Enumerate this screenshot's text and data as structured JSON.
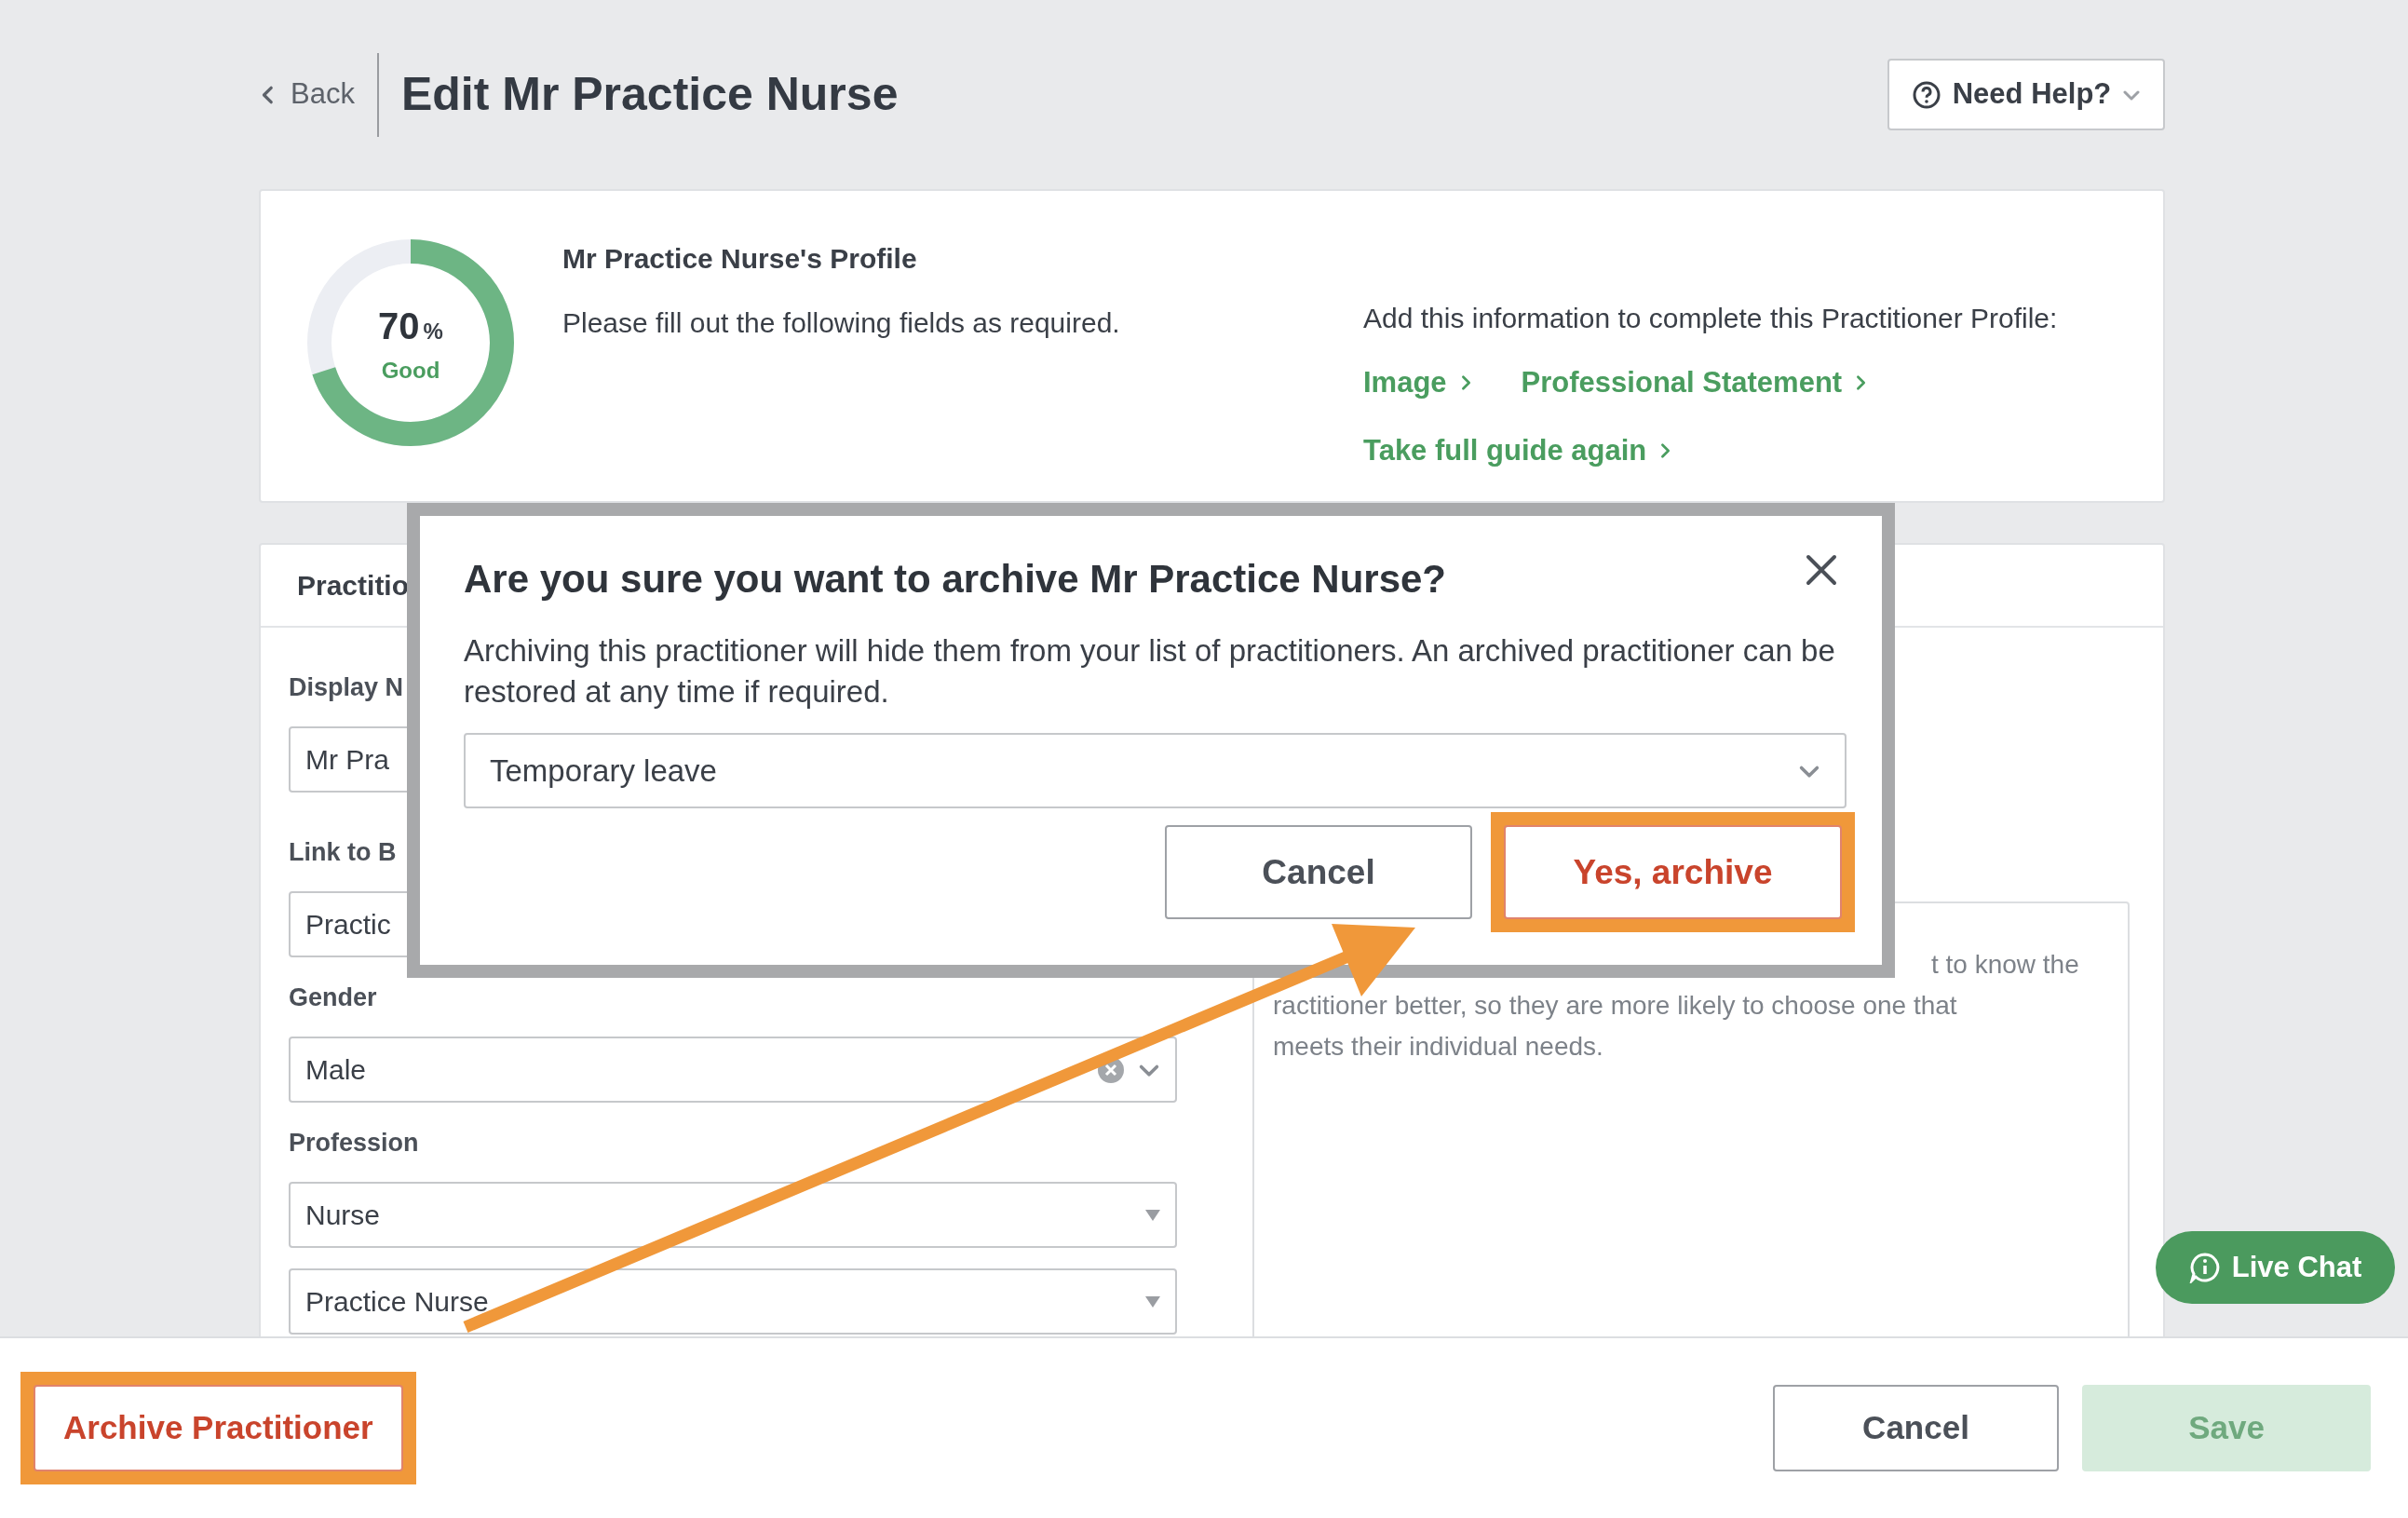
{
  "header": {
    "back": "Back",
    "title": "Edit Mr Practice Nurse",
    "help_button": "Need Help?"
  },
  "profile": {
    "score": "70",
    "unit": "%",
    "rating": "Good",
    "level": 0.7,
    "heading": "Mr Practice Nurse's Profile",
    "instruction": "Please fill out the following fields as required.",
    "prompt": "Add this information to complete this Practitioner Profile:",
    "links": [
      "Image",
      "Professional Statement",
      "Take full guide again"
    ]
  },
  "form": {
    "tab": "Practitio",
    "fields": [
      {
        "kind": "text",
        "label": "Display N",
        "value": "Mr Pra"
      },
      {
        "kind": "text",
        "label": "Link to B",
        "value": "Practic"
      },
      {
        "kind": "clearable",
        "label": "Gender",
        "value": "Male"
      },
      {
        "kind": "dropdown",
        "label": "Profession",
        "value": "Nurse"
      },
      {
        "kind": "dropdown",
        "value": "Practice Nurse"
      }
    ],
    "statement_lines": [
      "t to know the",
      "ractitioner better, so they are more likely to choose one that",
      "meets their individual needs."
    ]
  },
  "modal": {
    "title": "Are you sure you want to archive Mr Practice Nurse?",
    "message": "Archiving this practitioner will hide them from your list of practitioners. An archived practitioner can be restored at any time if required.",
    "reason": "Temporary leave",
    "buttons": [
      {
        "kind": "secondary",
        "label": "Cancel",
        "highlighted": false
      },
      {
        "kind": "danger",
        "label": "Yes, archive",
        "highlighted": true
      }
    ]
  },
  "live_chat": "Live Chat",
  "footer": {
    "archive": {
      "label": "Archive Practitioner",
      "highlighted": true
    },
    "cancel": "Cancel",
    "save": {
      "label": "Save",
      "disabled": true
    }
  }
}
